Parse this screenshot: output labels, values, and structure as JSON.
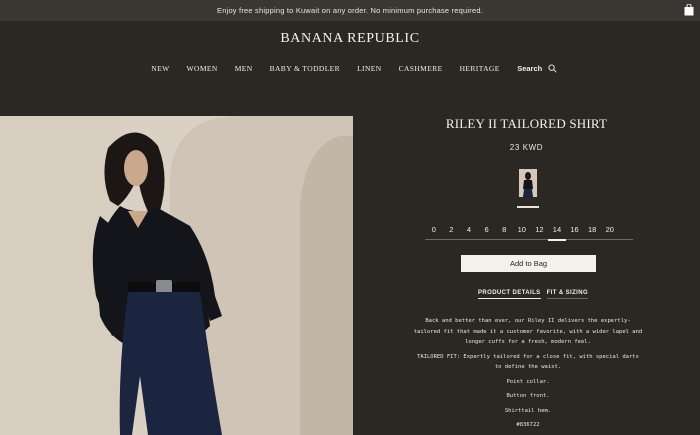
{
  "promo": {
    "text": "Enjoy free shipping to Kuwait on any order. No minimum purchase required.",
    "icon": "shopping-bag-icon"
  },
  "header": {
    "logo": "BANANA REPUBLIC"
  },
  "nav": {
    "items": [
      "NEW",
      "WOMEN",
      "MEN",
      "BABY & TODDLER",
      "LINEN",
      "CASHMERE",
      "HERITAGE"
    ],
    "search_label": "Search",
    "search_icon": "search-icon"
  },
  "product": {
    "title": "RILEY II TAILORED SHIRT",
    "price": "23 KWD",
    "sizes": [
      "0",
      "2",
      "4",
      "6",
      "8",
      "10",
      "12",
      "14",
      "16",
      "18",
      "20"
    ],
    "selected_size": "14",
    "add_to_bag": "Add to Bag",
    "tabs": [
      "PRODUCT DETAILS",
      "FIT & SIZING"
    ],
    "active_tab": "PRODUCT DETAILS",
    "description": [
      "Back and better than ever, our Riley II delivers the expertly-tailored fit that made it a customer favorite, with a wider lapel and longer cuffs for a fresh, modern feel.",
      "TAILORED FIT: Expertly tailored for a close fit, with special darts to define the waist.",
      "Point collar.",
      "Button front.",
      "Shirttail hem.",
      "#836722"
    ]
  },
  "colors": {
    "background": "#2b2824",
    "promo_bar": "#3a3733",
    "button": "#f4f1eb"
  }
}
